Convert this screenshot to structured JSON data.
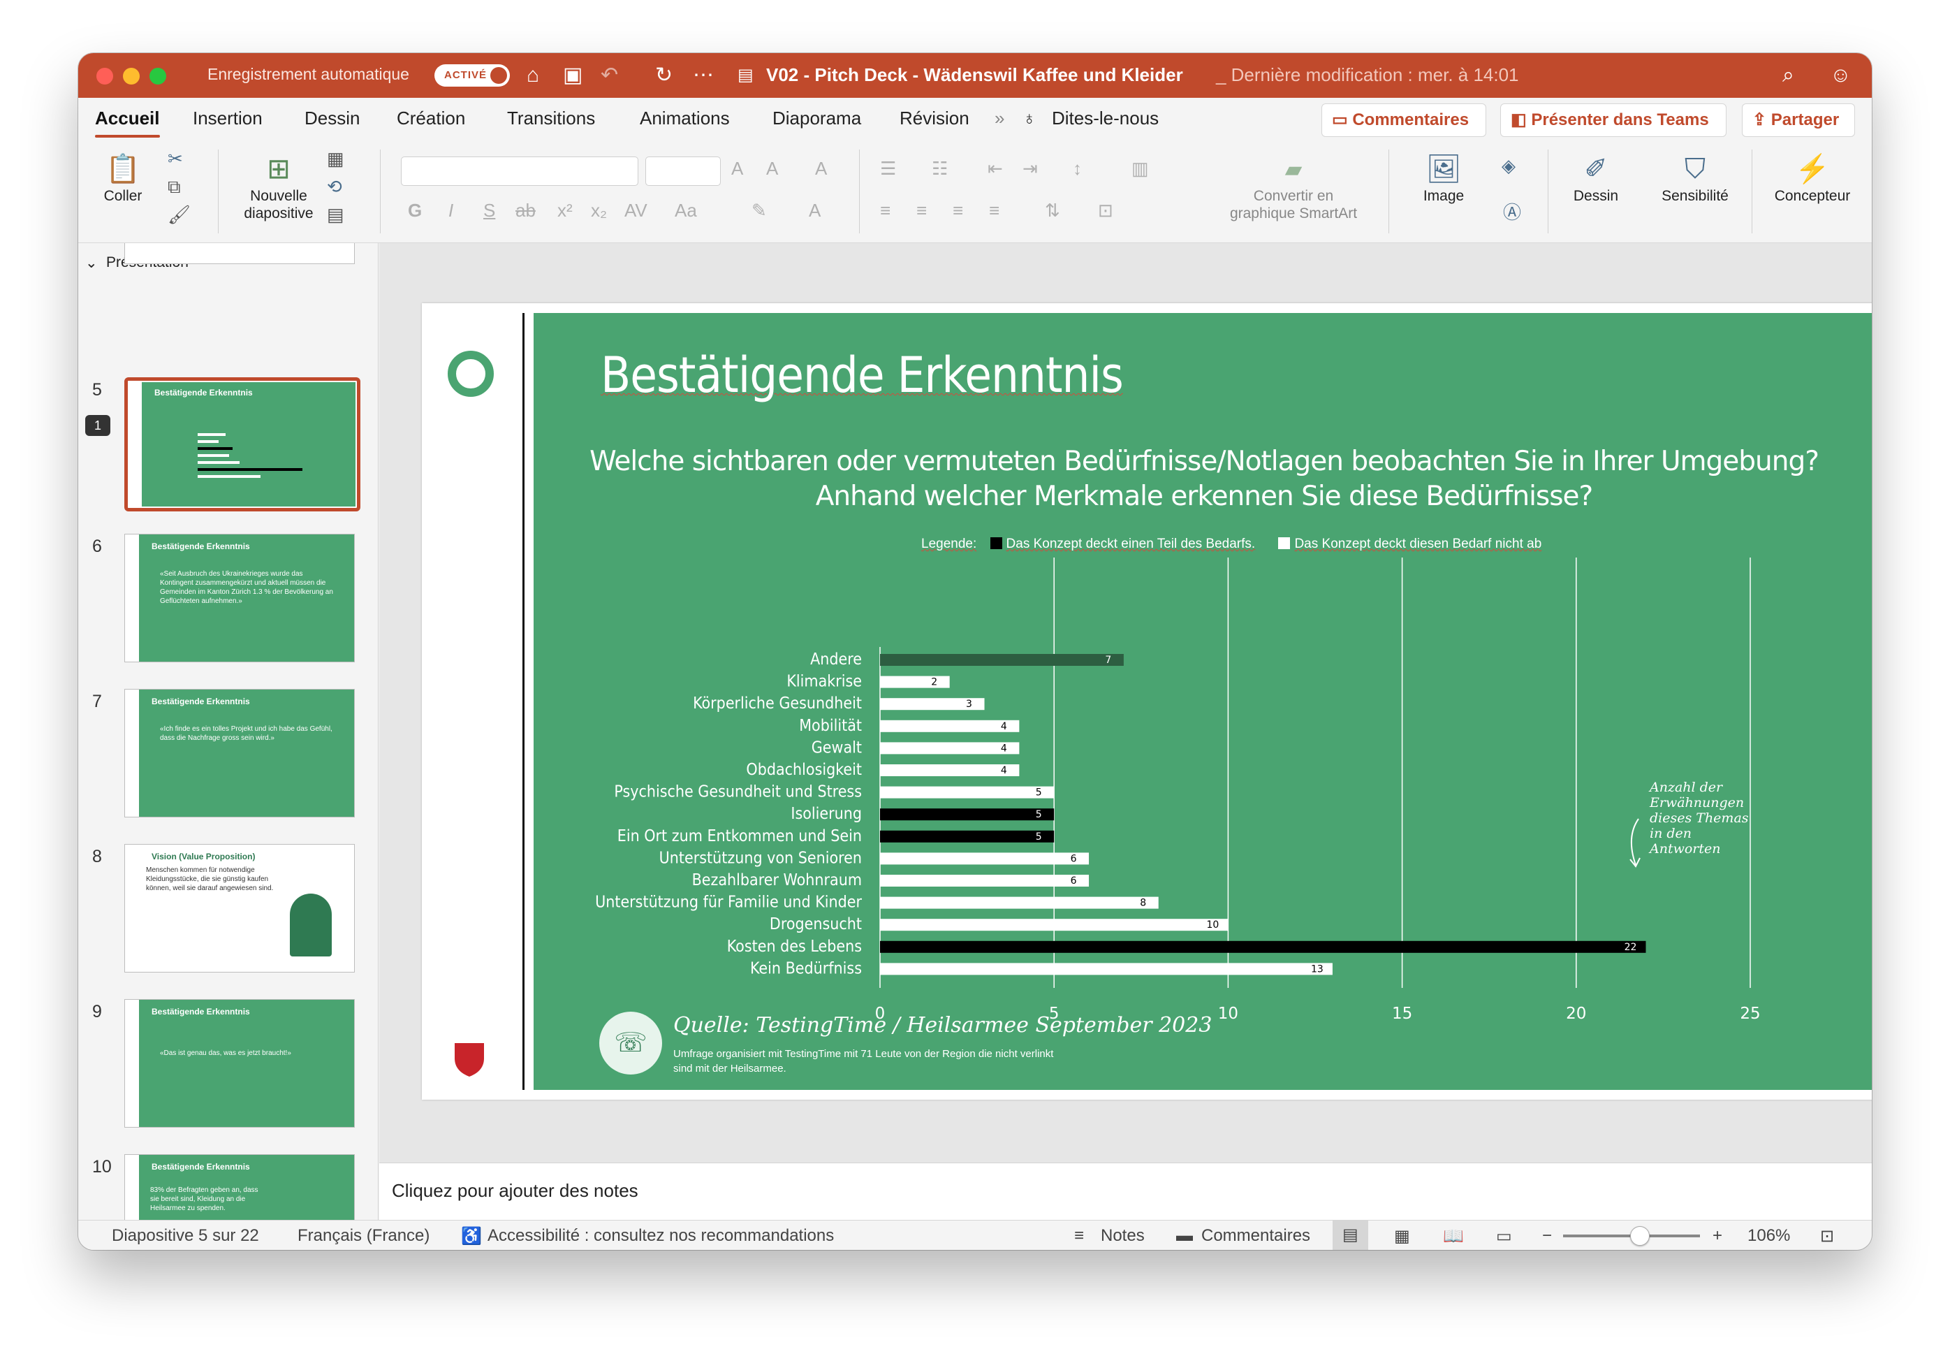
{
  "titlebar": {
    "autosave_label": "Enregistrement automatique",
    "autosave_toggle": "ACTIVÉ",
    "doc_title": "V02 - Pitch Deck - Wädenswil Kaffee und Kleider",
    "last_modified": "_ Dernière modification : mer. à 14:01"
  },
  "tabs": [
    "Accueil",
    "Insertion",
    "Dessin",
    "Création",
    "Transitions",
    "Animations",
    "Diaporama",
    "Révision"
  ],
  "tell_me": "Dites-le-nous",
  "ribbon_buttons": {
    "comments": "Commentaires",
    "present_teams": "Présenter dans Teams",
    "share": "Partager"
  },
  "ribbon": {
    "paste": "Coller",
    "new_slide_1": "Nouvelle",
    "new_slide_2": "diapositive",
    "smartart_1": "Convertir en",
    "smartart_2": "graphique SmartArt",
    "image": "Image",
    "drawing": "Dessin",
    "sensitivity": "Sensibilité",
    "designer": "Concepteur"
  },
  "left_pane": {
    "section": "Présentation",
    "comment_count": "1",
    "thumbs": [
      {
        "num": "5",
        "title": "Bestätigende Erkenntnis",
        "body": ""
      },
      {
        "num": "6",
        "title": "Bestätigende Erkenntnis",
        "body": "«Seit Ausbruch des Ukrainekrieges wurde das Kontingent zusammengekürzt und aktuell müssen die Gemeinden im Kanton Zürich 1.3 % der Bevölkerung an Geflüchteten aufnehmen.»"
      },
      {
        "num": "7",
        "title": "Bestätigende Erkenntnis",
        "body": "«Ich finde es ein tolles Projekt und ich habe das Gefühl, dass die Nachfrage gross sein wird.»"
      },
      {
        "num": "8",
        "title": "Vision (Value Proposition)",
        "body": "Menschen kommen für notwendige Kleidungsstücke, die sie günstig kaufen können, weil sie darauf angewiesen sind."
      },
      {
        "num": "9",
        "title": "Bestätigende Erkenntnis",
        "body": "«Das ist genau das, was es jetzt braucht!»"
      },
      {
        "num": "10",
        "title": "Bestätigende Erkenntnis",
        "body": "83% der Befragten geben an, dass sie bereit sind, Kleidung an die Heilsarmee zu spenden."
      }
    ]
  },
  "slide": {
    "title": "Bestätigende Erkenntnis",
    "question_1": "Welche sichtbaren oder vermuteten Bedürfnisse/Notlagen beobachten Sie in Ihrer Umgebung?",
    "question_2": "Anhand welcher Merkmale erkennen Sie diese Bedürfnisse?",
    "legend_label": "Legende:",
    "legend_black": "Das Konzept deckt einen Teil des Bedarfs.",
    "legend_white": "Das Konzept deckt diesen Bedarf nicht ab",
    "annotation": "Anzahl der Erwähnungen dieses Themas in den Antworten",
    "source_title": "Quelle: TestingTime / Heilsarmee September 2023",
    "source_desc": "Umfrage organisiert mit TestingTime mit 71 Leute von der Region die nicht verlinkt sind mit der Heilsarmee."
  },
  "chart_data": {
    "type": "bar",
    "orientation": "horizontal",
    "categories": [
      "Andere",
      "Klimakrise",
      "Körperliche Gesundheit",
      "Mobilität",
      "Gewalt",
      "Obdachlosigkeit",
      "Psychische Gesundheit und Stress",
      "Isolierung",
      "Ein Ort zum Entkommen und Sein",
      "Unterstützung von Senioren",
      "Bezahlbarer Wohnraum",
      "Unterstützung für Familie und Kinder",
      "Drogensucht",
      "Kosten des Lebens",
      "Kein Bedürfniss"
    ],
    "values": [
      7,
      2,
      3,
      4,
      4,
      4,
      5,
      5,
      5,
      6,
      6,
      8,
      10,
      22,
      13
    ],
    "bar_kind": [
      "other",
      "uncovered",
      "uncovered",
      "uncovered",
      "uncovered",
      "uncovered",
      "uncovered",
      "covered",
      "covered",
      "uncovered",
      "uncovered",
      "uncovered",
      "uncovered",
      "covered",
      "uncovered"
    ],
    "colors": {
      "covered": "#000000",
      "uncovered": "#ffffff",
      "other": "#2d5e41"
    },
    "xlim": [
      0,
      25
    ],
    "xticks": [
      0,
      5,
      10,
      15,
      20,
      25
    ],
    "grid": true
  },
  "notes_placeholder": "Cliquez pour ajouter des notes",
  "status": {
    "slide_info": "Diapositive 5 sur 22",
    "language": "Français (France)",
    "accessibility": "Accessibilité : consultez nos recommandations",
    "notes": "Notes",
    "comments": "Commentaires",
    "zoom": "106%",
    "zoom_level": 0.56
  },
  "colors": {
    "accent": "#c04a2c",
    "slide_green": "#4aa471"
  }
}
